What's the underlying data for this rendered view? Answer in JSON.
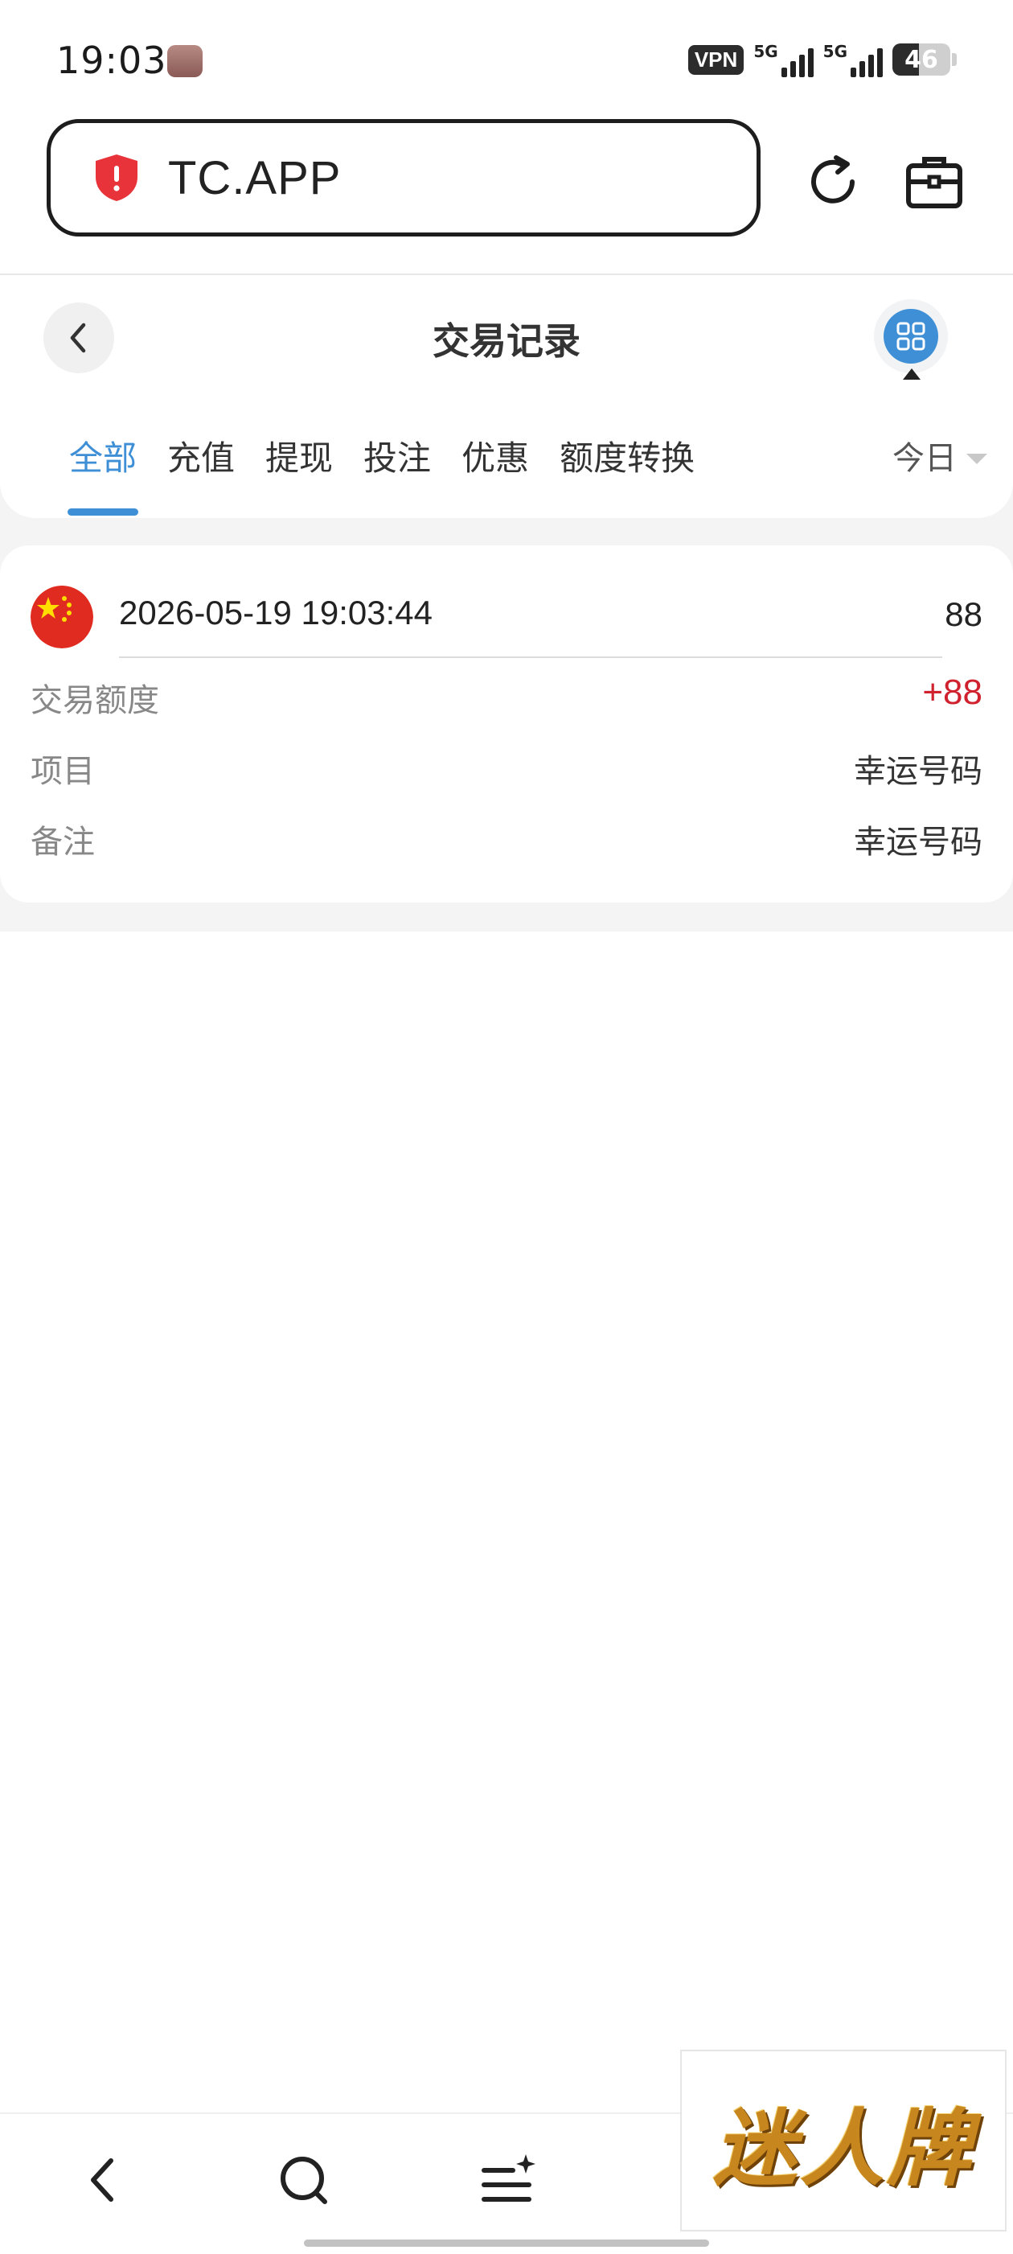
{
  "status_bar": {
    "time": "19:03",
    "vpn": "VPN",
    "network1": "5G",
    "network2": "5G",
    "battery": "46",
    "battery_level": 0.46
  },
  "browser": {
    "url": "TC.APP",
    "security_color": "#e8333a"
  },
  "page": {
    "title": "交易记录",
    "accent_color": "#3e8fd6",
    "tabs": [
      {
        "label": "全部",
        "active": true
      },
      {
        "label": "充值",
        "active": false
      },
      {
        "label": "提现",
        "active": false
      },
      {
        "label": "投注",
        "active": false
      },
      {
        "label": "优惠",
        "active": false
      },
      {
        "label": "额度转换",
        "active": false
      }
    ],
    "range": "今日"
  },
  "record": {
    "time": "2026-05-19 19:03:44",
    "amount": "88",
    "rows": [
      {
        "label": "交易额度",
        "value": "+88",
        "color": "#d0212e"
      },
      {
        "label": "项目",
        "value": "幸运号码"
      },
      {
        "label": "备注",
        "value": "幸运号码"
      }
    ]
  },
  "ad": {
    "text": "迷人牌"
  }
}
